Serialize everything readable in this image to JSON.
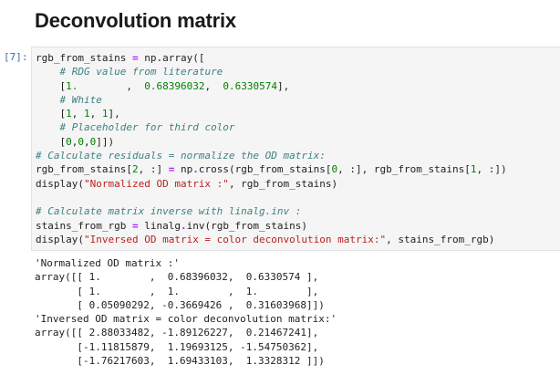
{
  "notebook": {
    "heading": "Deconvolution matrix",
    "cell": {
      "prompt": "[7]:",
      "code_lines": [
        [
          {
            "t": "rgb_from_stains ",
            "c": ""
          },
          {
            "t": "=",
            "c": "op"
          },
          {
            "t": " np",
            "c": ""
          },
          {
            "t": ".",
            "c": "op"
          },
          {
            "t": "array([",
            "c": ""
          }
        ],
        [
          {
            "t": "    ",
            "c": ""
          },
          {
            "t": "# RDG value from literature",
            "c": "cm"
          }
        ],
        [
          {
            "t": "    [",
            "c": ""
          },
          {
            "t": "1.",
            "c": "num"
          },
          {
            "t": "        ,  ",
            "c": ""
          },
          {
            "t": "0.68396032",
            "c": "num"
          },
          {
            "t": ",  ",
            "c": ""
          },
          {
            "t": "0.6330574",
            "c": "num"
          },
          {
            "t": "],",
            "c": ""
          }
        ],
        [
          {
            "t": "    ",
            "c": ""
          },
          {
            "t": "# White",
            "c": "cm"
          }
        ],
        [
          {
            "t": "    [",
            "c": ""
          },
          {
            "t": "1",
            "c": "num"
          },
          {
            "t": ", ",
            "c": ""
          },
          {
            "t": "1",
            "c": "num"
          },
          {
            "t": ", ",
            "c": ""
          },
          {
            "t": "1",
            "c": "num"
          },
          {
            "t": "],",
            "c": ""
          }
        ],
        [
          {
            "t": "    ",
            "c": ""
          },
          {
            "t": "# Placeholder for third color",
            "c": "cm"
          }
        ],
        [
          {
            "t": "    [",
            "c": ""
          },
          {
            "t": "0",
            "c": "num"
          },
          {
            "t": ",",
            "c": ""
          },
          {
            "t": "0",
            "c": "num"
          },
          {
            "t": ",",
            "c": ""
          },
          {
            "t": "0",
            "c": "num"
          },
          {
            "t": "]])",
            "c": ""
          }
        ],
        [
          {
            "t": "# Calculate residuals = normalize the OD matrix:",
            "c": "cm"
          }
        ],
        [
          {
            "t": "rgb_from_stains[",
            "c": ""
          },
          {
            "t": "2",
            "c": "num"
          },
          {
            "t": ", :] ",
            "c": ""
          },
          {
            "t": "=",
            "c": "op"
          },
          {
            "t": " np",
            "c": ""
          },
          {
            "t": ".",
            "c": "op"
          },
          {
            "t": "cross(rgb_from_stains[",
            "c": ""
          },
          {
            "t": "0",
            "c": "num"
          },
          {
            "t": ", :], rgb_from_stains[",
            "c": ""
          },
          {
            "t": "1",
            "c": "num"
          },
          {
            "t": ", :])",
            "c": ""
          }
        ],
        [
          {
            "t": "display(",
            "c": ""
          },
          {
            "t": "\"Normalized OD matrix :\"",
            "c": "str"
          },
          {
            "t": ", rgb_from_stains)",
            "c": ""
          }
        ],
        [
          {
            "t": "",
            "c": ""
          }
        ],
        [
          {
            "t": "# Calculate matrix inverse with linalg.inv :",
            "c": "cm"
          }
        ],
        [
          {
            "t": "stains_from_rgb ",
            "c": ""
          },
          {
            "t": "=",
            "c": "op"
          },
          {
            "t": " linalg",
            "c": ""
          },
          {
            "t": ".",
            "c": "op"
          },
          {
            "t": "inv(rgb_from_stains)",
            "c": ""
          }
        ],
        [
          {
            "t": "display(",
            "c": ""
          },
          {
            "t": "\"Inversed OD matrix = color deconvolution matrix:\"",
            "c": "str"
          },
          {
            "t": ", stains_from_rgb)",
            "c": ""
          }
        ]
      ]
    },
    "output_lines": [
      "'Normalized OD matrix :'",
      "array([[ 1.        ,  0.68396032,  0.6330574 ],",
      "       [ 1.        ,  1.        ,  1.        ],",
      "       [ 0.05090292, -0.3669426 ,  0.31603968]])",
      "'Inversed OD matrix = color deconvolution matrix:'",
      "array([[ 2.88033482, -1.89126227,  0.21467241],",
      "       [-1.11815879,  1.19693125, -1.54750362],",
      "       [-1.76217603,  1.69433103,  1.3328312 ]])"
    ]
  }
}
